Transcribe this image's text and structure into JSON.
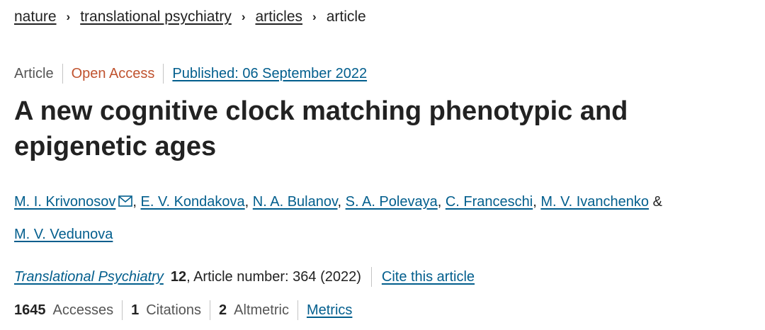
{
  "breadcrumb": {
    "items": [
      "nature",
      "translational psychiatry",
      "articles"
    ],
    "current": "article"
  },
  "meta": {
    "type": "Article",
    "access": "Open Access",
    "published": "Published: 06 September 2022"
  },
  "title": {
    "line1": "A new cognitive clock matching phenotypic and",
    "line2": "epigenetic ages"
  },
  "authors": {
    "list": [
      "M. I. Krivonosov",
      "E. V. Kondakova",
      "N. A. Bulanov",
      "S. A. Polevaya",
      "C. Franceschi",
      "M. V. Ivanchenko",
      "M. V. Vedunova"
    ],
    "separator": ",",
    "conjunction": "&"
  },
  "citation": {
    "journal": "Translational Psychiatry",
    "volume": "12",
    "details": ", Article number: 364 (2022)",
    "cite_link": "Cite this article"
  },
  "metrics": {
    "accesses_count": "1645",
    "accesses_label": "Accesses",
    "citations_count": "1",
    "citations_label": "Citations",
    "altmetric_count": "2",
    "altmetric_label": "Altmetric",
    "metrics_link": "Metrics"
  },
  "colors": {
    "link": "#025e8d",
    "open_access": "#c0532f",
    "text": "#222222",
    "divider": "#c4c4c4"
  },
  "icons": {
    "email": "mail-icon",
    "breadcrumb_separator": "chevron-right-icon"
  }
}
